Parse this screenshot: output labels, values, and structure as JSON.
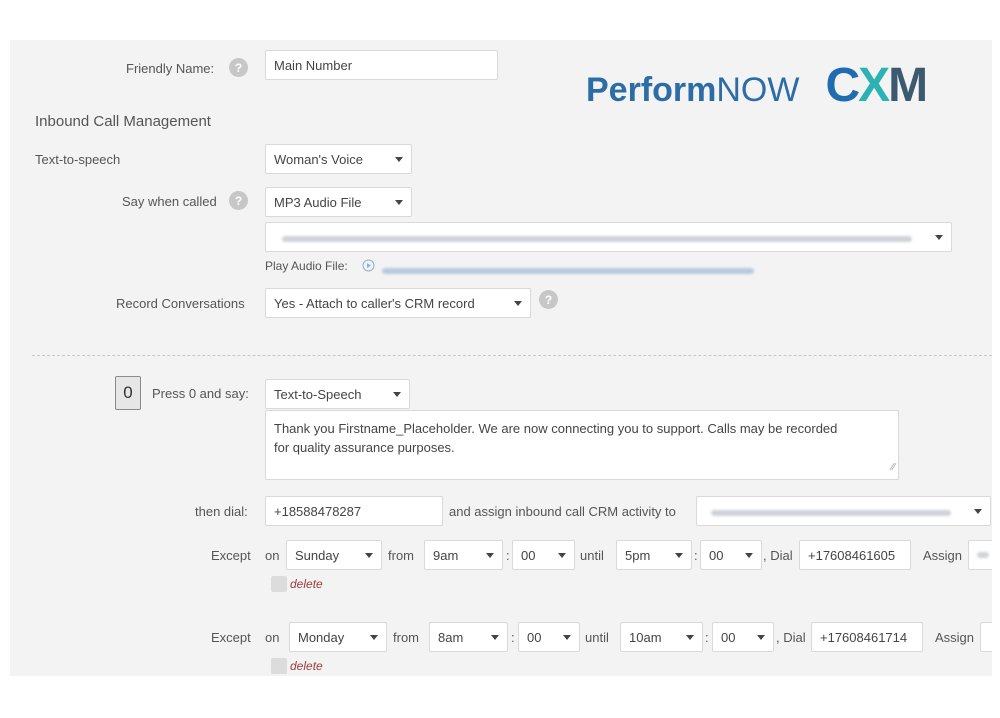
{
  "logo": {
    "perform": "Perform",
    "now": "NOW",
    "c": "C",
    "x": "X",
    "m": "M"
  },
  "friendly_name": {
    "label": "Friendly Name:",
    "value": "Main Number"
  },
  "section_title": "Inbound Call Management",
  "tts": {
    "label": "Text-to-speech",
    "value": "Woman's Voice"
  },
  "say_when_called": {
    "label": "Say when called",
    "value": "MP3 Audio File",
    "play_label": "Play Audio File:"
  },
  "record": {
    "label": "Record Conversations",
    "value": "Yes - Attach to caller's CRM record"
  },
  "menu_option": {
    "key": "0",
    "press_label": "Press 0 and say:",
    "say_type": "Text-to-Speech",
    "message_line1": "Thank you Firstname_Placeholder. We are now connecting you to support. Calls may be recorded",
    "message_line2": "for quality assurance purposes.",
    "then_dial_label": "then dial:",
    "dial_number": "+18588478287",
    "assign_label": "and assign inbound call CRM activity to"
  },
  "exceptions": [
    {
      "except": "Except",
      "on": "on",
      "day": "Sunday",
      "from": "from",
      "from_hour": "9am",
      "colon": ":",
      "from_min": "00",
      "until": "until",
      "until_hour": "5pm",
      "until_min": "00",
      "dial_label": ", Dial",
      "number": "+17608461605",
      "assign": "Assign",
      "delete": "delete"
    },
    {
      "except": "Except",
      "on": "on",
      "day": "Monday",
      "from": "from",
      "from_hour": "8am",
      "colon": ":",
      "from_min": "00",
      "until": "until",
      "until_hour": "10am",
      "until_min": "00",
      "dial_label": ", Dial",
      "number": "+17608461714",
      "assign": "Assign",
      "delete": "delete"
    }
  ],
  "icons": {
    "help": "question-circle-icon",
    "play": "play-circle-icon",
    "dropdown": "caret-down-icon",
    "resize": "resize-handle-icon"
  }
}
